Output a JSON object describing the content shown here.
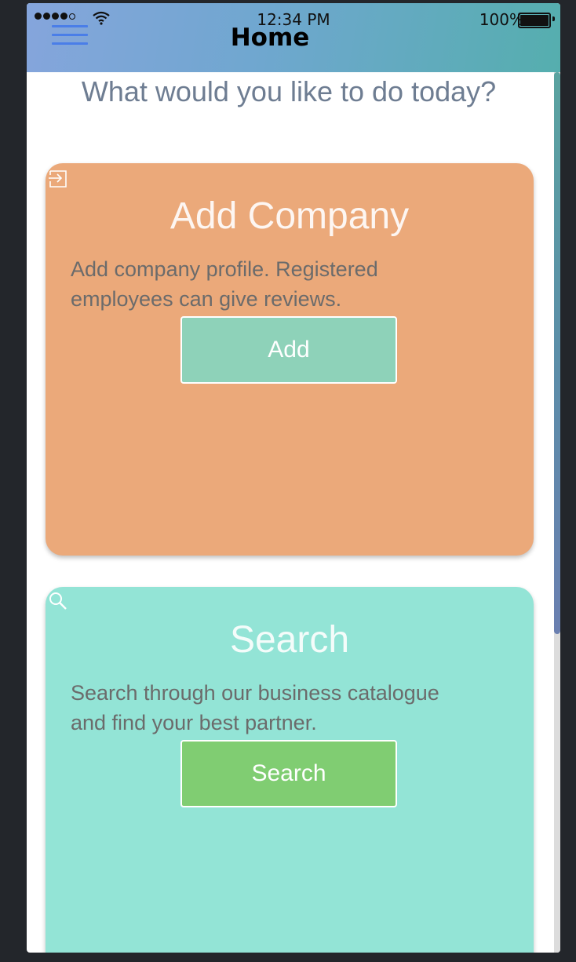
{
  "status_bar": {
    "time": "12:34 PM",
    "battery": "100%",
    "icons": [
      "signal-icon",
      "wifi-icon",
      "battery-icon"
    ]
  },
  "nav": {
    "title": "Home",
    "menu_icon": "hamburger-menu-icon"
  },
  "main": {
    "prompt": "What would you like to do today?"
  },
  "cards": [
    {
      "icon": "login-arrow-icon",
      "title": "Add Company",
      "description": "Add company profile. Registered employees can give reviews.",
      "button_label": "Add",
      "background": "#eba97a",
      "button_color": "#8ed2b9"
    },
    {
      "icon": "search-icon",
      "title": "Search",
      "description": "Search through our business catalogue and find your best partner.",
      "button_label": "Search",
      "background": "#93e4d6",
      "button_color": "#80cd72"
    }
  ],
  "colors": {
    "header_gradient_start": "#85a5dc",
    "header_gradient_end": "#55aeae",
    "prompt_text": "#6e7d92"
  }
}
